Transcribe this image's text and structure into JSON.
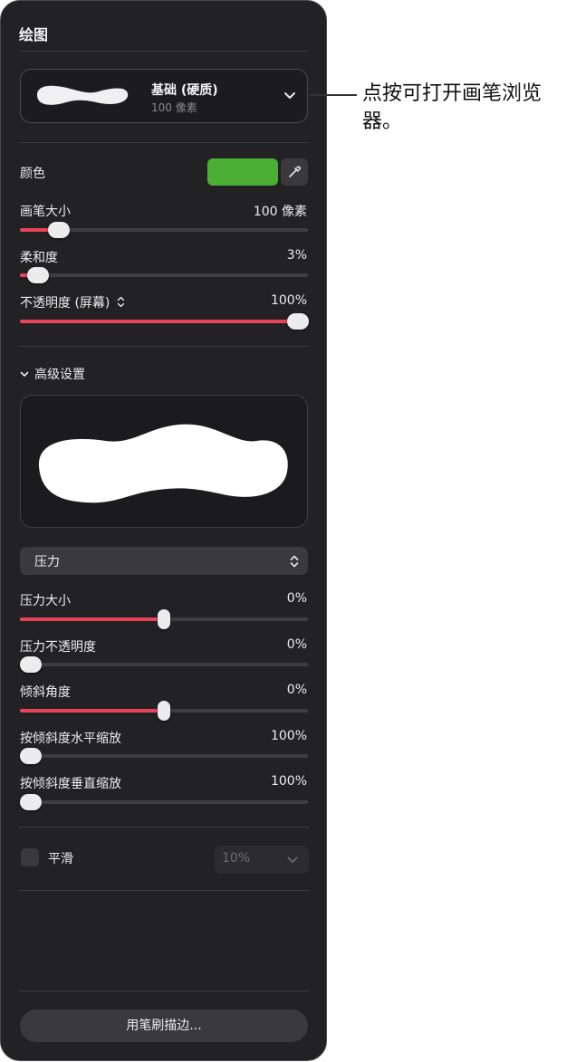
{
  "panel": {
    "title": "绘图",
    "brush": {
      "name": "基础 (硬质)",
      "size": "100 像素"
    },
    "color_label": "颜色",
    "color_value": "#4caf35",
    "brush_size": {
      "label": "画笔大小",
      "value": "100 像素",
      "fraction": 0.13
    },
    "smoothness": {
      "label": "柔和度",
      "value": "3%",
      "fraction": 0.03
    },
    "opacity": {
      "label": "不透明度 (屏幕)",
      "value": "100%",
      "fraction": 1.0
    },
    "advanced_label": "高级设置",
    "pressure_select": "压力",
    "pressure_size": {
      "label": "压力大小",
      "value": "0%",
      "fraction": 0.5
    },
    "pressure_opacity": {
      "label": "压力不透明度",
      "value": "0%",
      "fraction": 0.0
    },
    "tilt_angle": {
      "label": "倾斜角度",
      "value": "0%",
      "fraction": 0.5
    },
    "tilt_h_scale": {
      "label": "按倾斜度水平缩放",
      "value": "100%",
      "fraction": 0.0
    },
    "tilt_v_scale": {
      "label": "按倾斜度垂直缩放",
      "value": "100%",
      "fraction": 0.0
    },
    "smooth": {
      "label": "平滑",
      "value": "10%"
    },
    "stroke_button": "用笔刷描边..."
  },
  "callout": {
    "text": "点按可打开画笔浏览器。"
  },
  "colors": {
    "accent": "#e9435a",
    "swatch": "#4caf35"
  }
}
